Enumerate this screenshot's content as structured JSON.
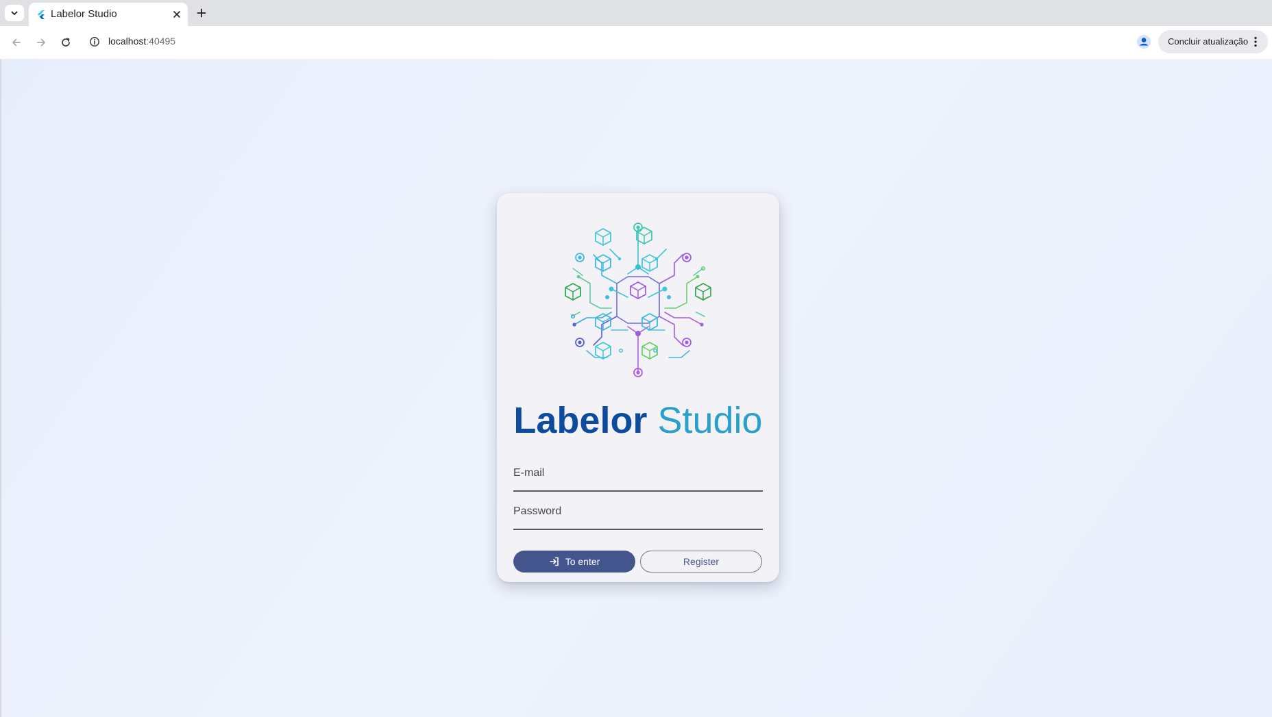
{
  "browser": {
    "tab": {
      "title": "Labelor Studio"
    },
    "address_bar": {
      "host": "localhost",
      "port": ":40495"
    },
    "update_button_label": "Concluir atualização"
  },
  "login": {
    "brand_bold": "Labelor",
    "brand_light": "Studio",
    "email_label": "E-mail",
    "password_label": "Password",
    "enter_button_label": "To enter",
    "register_button_label": "Register"
  },
  "colors": {
    "brand_primary": "#0c4b9e",
    "brand_secondary": "#2a9fc9",
    "primary_button": "#44548c",
    "page_background": "#ebf0fb",
    "card_background": "#f3f3f7"
  },
  "icons": {
    "tab_list": "chevron-down-icon",
    "favicon": "flutter-icon",
    "tab_close": "close-icon",
    "new_tab": "plus-icon",
    "back": "arrow-left-icon",
    "forward": "arrow-right-icon",
    "reload": "reload-icon",
    "site_info": "info-icon",
    "bookmark": "star-icon",
    "profile": "person-icon",
    "menu": "kebab-menu-icon",
    "login": "login-icon"
  }
}
